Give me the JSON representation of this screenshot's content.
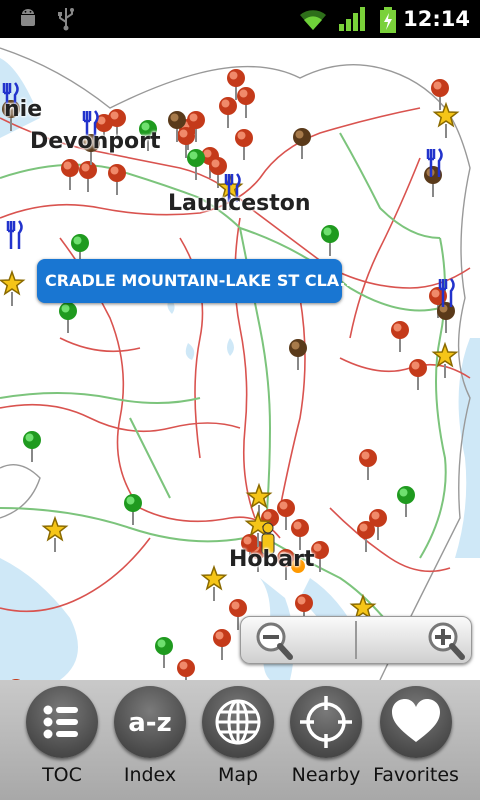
{
  "status_bar": {
    "time": "12:14",
    "icons": [
      "android-debug-icon",
      "usb-icon",
      "wifi-icon",
      "signal-icon",
      "battery-charging-icon"
    ]
  },
  "map": {
    "place_labels": {
      "partial_west": "nie",
      "devonport": "Devonport",
      "launceston": "Launceston",
      "hobart": "Hobart"
    },
    "callout": "CRADLE MOUNTAIN-LAKE ST CLA...",
    "marker_legend": {
      "red": "attraction-pin-icon",
      "green": "park-pin-icon",
      "brown": "place-pin-icon",
      "star": "favorite-star-icon",
      "fork_knife": "restaurant-icon",
      "person": "my-location-icon"
    },
    "zoom_controls": [
      "zoom-out-button",
      "zoom-in-button"
    ]
  },
  "toolbar": {
    "items": [
      {
        "label": "TOC",
        "icon": "list-icon"
      },
      {
        "label": "Index",
        "icon": "a-z-icon"
      },
      {
        "label": "Map",
        "icon": "globe-icon"
      },
      {
        "label": "Nearby",
        "icon": "crosshair-icon"
      },
      {
        "label": "Favorites",
        "icon": "heart-icon"
      }
    ]
  },
  "colors": {
    "callout": "#1976d2",
    "road_red": "#d9534f",
    "road_green": "#7cc47c",
    "water": "#cfe8f7",
    "status_bar": "#000000"
  }
}
